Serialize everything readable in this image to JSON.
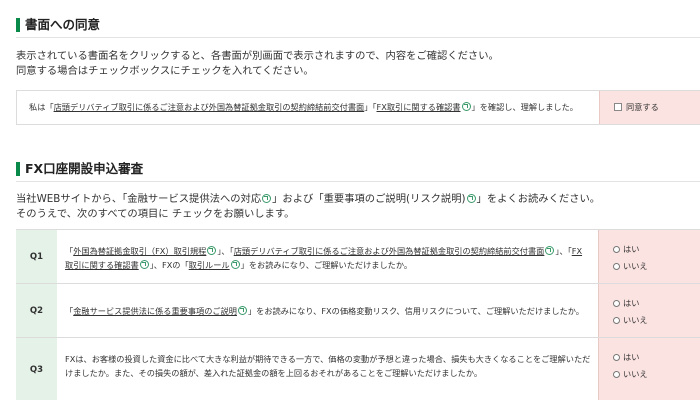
{
  "section1": {
    "title": "書面への同意",
    "line1": "表示されている書面名をクリックすると、各書面が別画面で表示されますので、内容をご確認ください。",
    "line2": "同意する場合はチェックボックスにチェックを入れてください。",
    "consent": {
      "prefix": "私は「",
      "doc1": "店頭デリバティブ取引に係るご注意および外国為替証拠金取引の契約締結前交付書面",
      "mid": "」「",
      "doc2": "FX取引に関する確認書",
      "suffix": "」を確認し、理解しました。",
      "agree_label": "同意する"
    }
  },
  "section2": {
    "title": "FX口座開設申込審査",
    "line1_a": "当社WEBサイトから、「",
    "line1_link1": "金融サービス提供法への対応",
    "line1_b": "」および「",
    "line1_link2": "重要事項のご説明(リスク説明)",
    "line1_c": "」をよくお読みください。",
    "line2": "そのうえで、次のすべての項目に チェックをお願いします。"
  },
  "questions": [
    {
      "num": "Q1",
      "l1_a": "「",
      "l1_link1": "外国為替証拠金取引（FX）取引規程",
      "l1_b": "」、「",
      "l1_link2": "店頭デリバティブ取引に係るご注意および外国為替証拠金取引の契約締結前交付書面",
      "l1_c": "」、「",
      "l1_link3": "FX",
      "l2_link3": "取引に関する確認書",
      "l2_a": "」、FXの「",
      "l2_link4": "取引ルール",
      "l2_b": "」をお読みになり、ご理解いただけましたか。",
      "yes": "はい",
      "no": "いいえ"
    },
    {
      "num": "Q2",
      "l1_a": "「",
      "l1_link1": "金融サービス提供法に係る重要事項のご説明",
      "l1_b": "」をお読みになり、FXの価格変動リスク、信用リスクについて、ご理解いただけましたか。",
      "yes": "はい",
      "no": "いいえ"
    },
    {
      "num": "Q3",
      "l1": "FXは、お客様の投資した資金に比べて大きな利益が期待できる一方で、価格の変動が予想と違った場合、損失も大きくなることをご理解いただ",
      "l2": "けましたか。また、その損失の額が、差入れた証拠金の額を上回るおそれがあることをご理解いただけましたか。",
      "yes": "はい",
      "no": "いいえ"
    }
  ],
  "colors": {
    "accent": "#0a8a4a",
    "answer_bg": "#fbe3e1",
    "qnum_bg": "#e4f2e8"
  }
}
